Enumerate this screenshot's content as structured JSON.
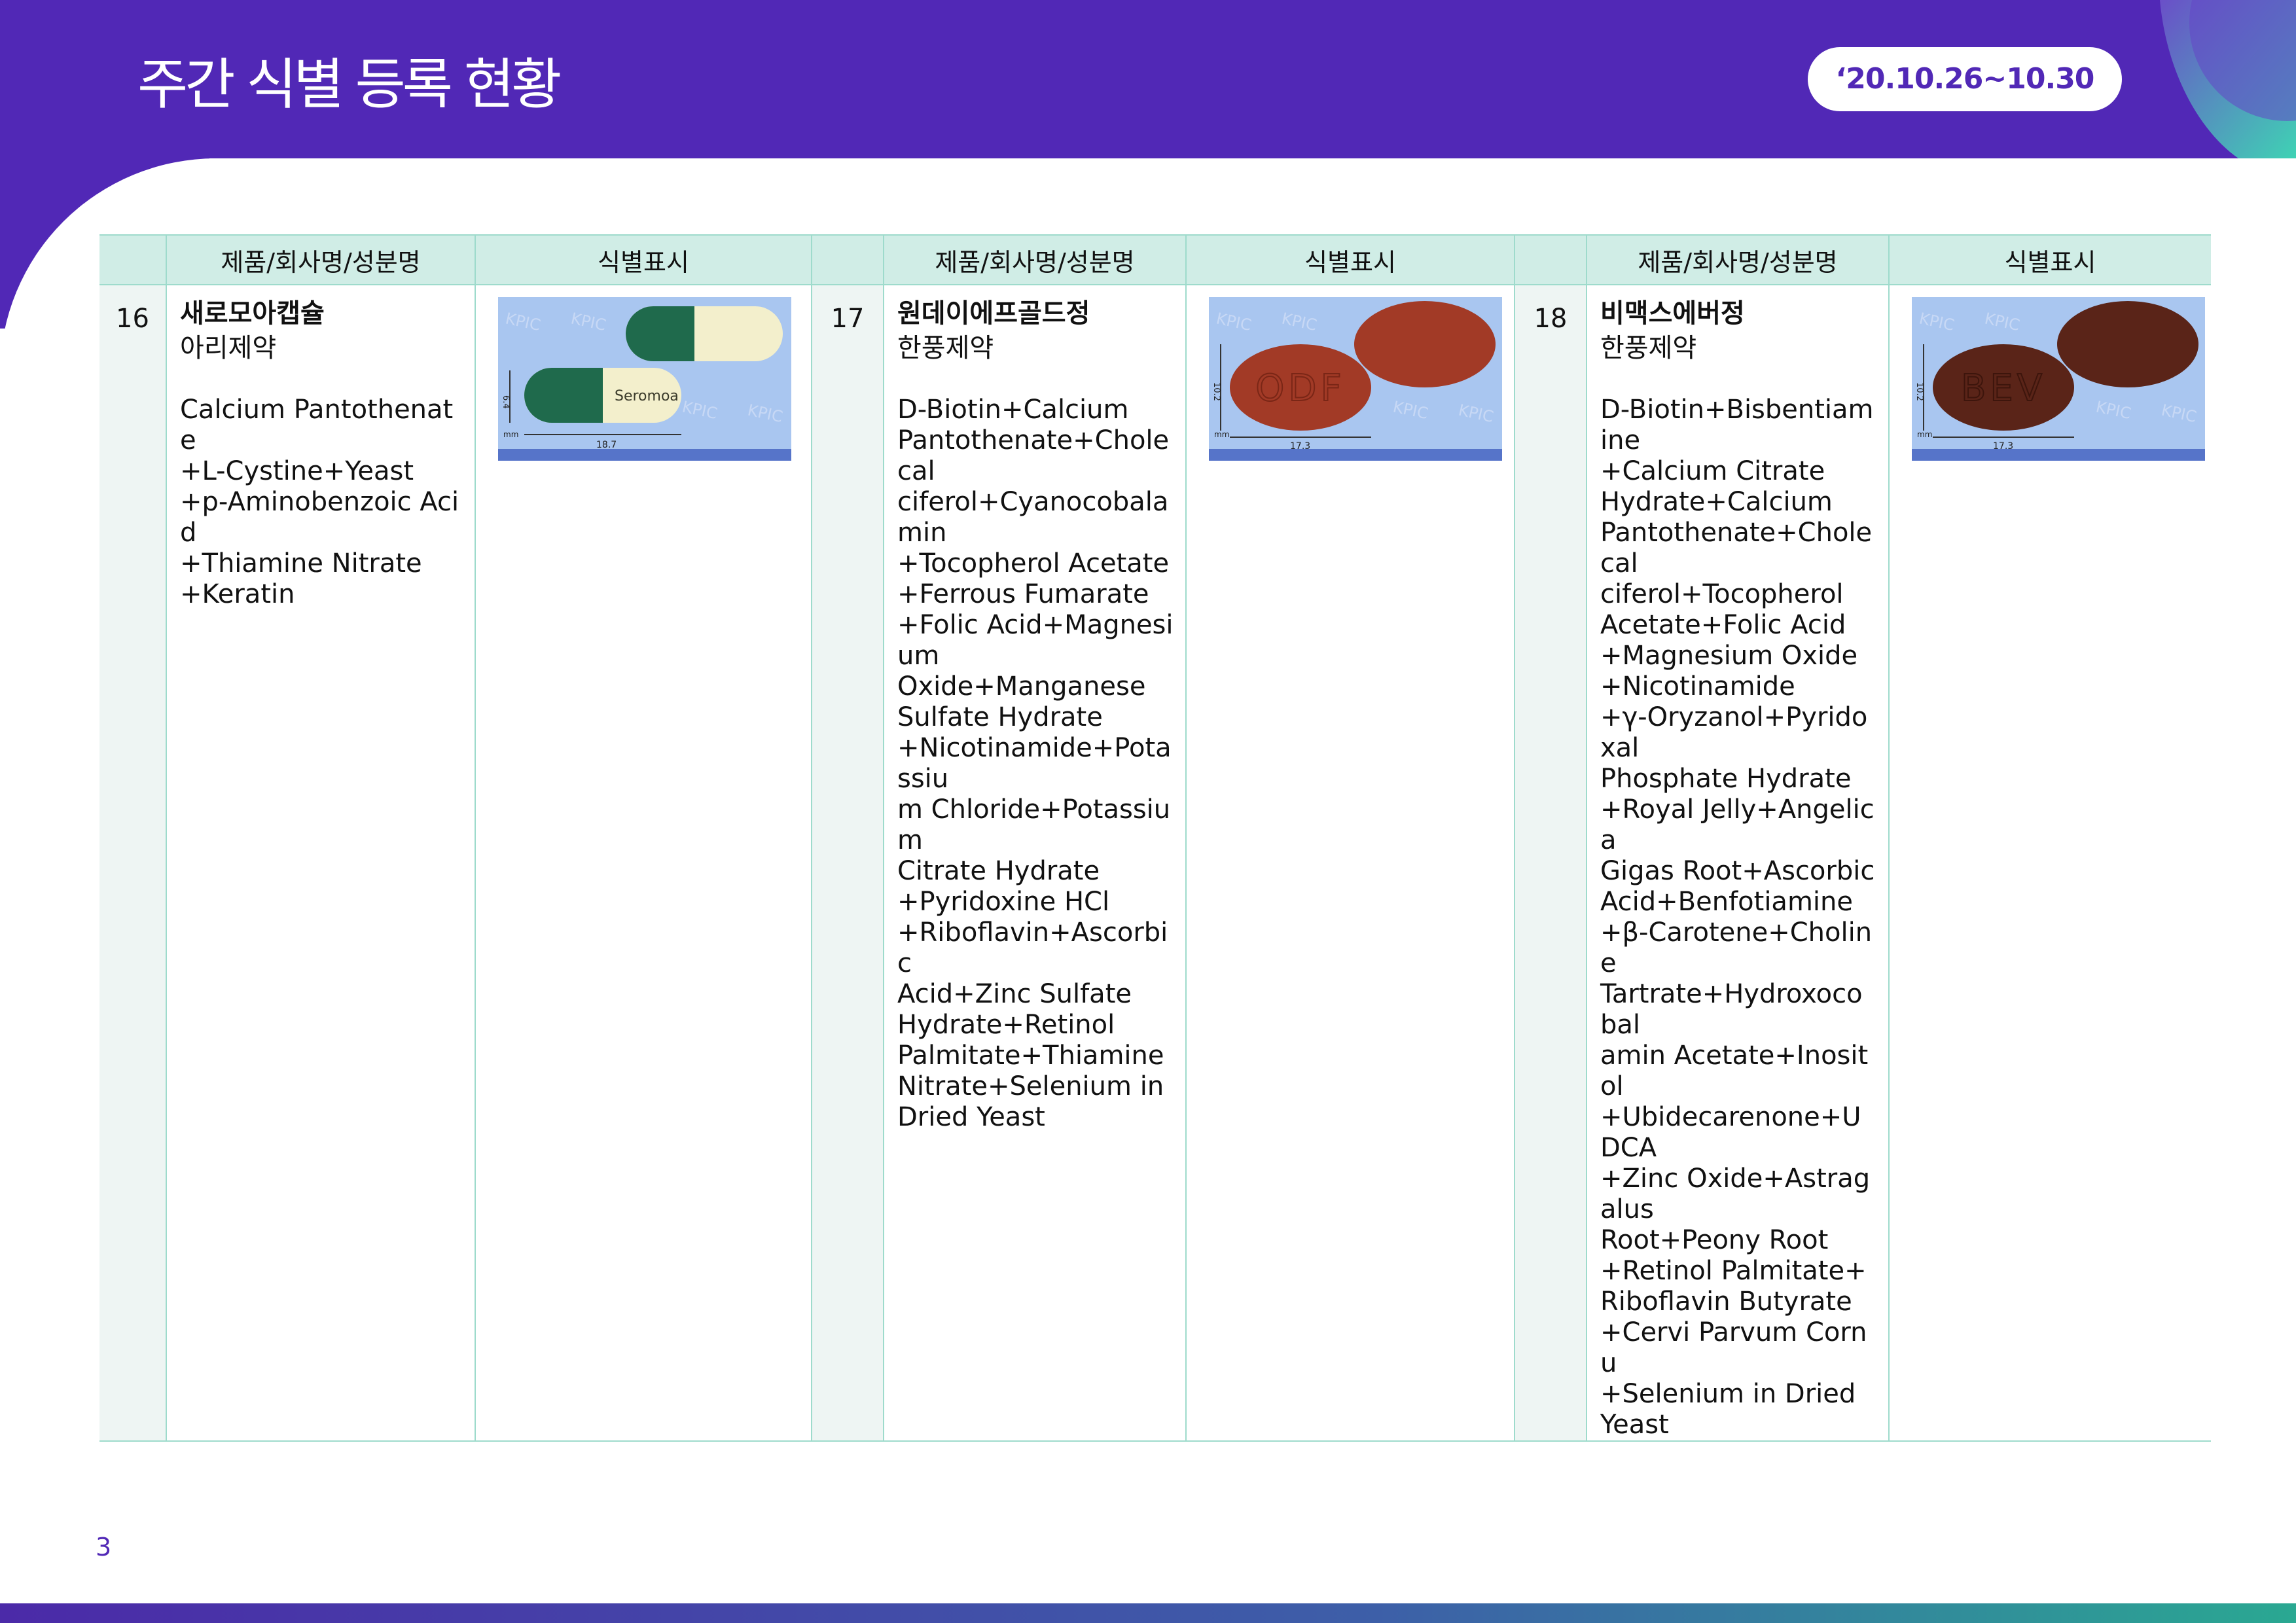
{
  "page": {
    "title": "주간 식별 등록 현황",
    "date_range": "‘20.10.26~10.30",
    "page_number": "3"
  },
  "table": {
    "headers": [
      "제품/회사명/성분명",
      "식별표시",
      "제품/회사명/성분명",
      "식별표시",
      "제품/회사명/성분명",
      "식별표시"
    ],
    "rows": [
      {
        "number": "16",
        "product": "새로모아캡슐",
        "company": "아리제약",
        "ingredients": [
          "Calcium Pantothenate",
          "+L-Cystine+Yeast",
          "+p-Aminobenzoic Acid",
          "+Thiamine Nitrate",
          "+Keratin"
        ],
        "image": {
          "type": "capsule",
          "imprint": "Seromoa",
          "dim_width": "18.7",
          "dim_height": "6.4",
          "unit": "mm",
          "watermark": "KPIC",
          "colors": {
            "cap": "#1f6a4c",
            "body": "#f3efcc"
          }
        }
      },
      {
        "number": "17",
        "product": "원데이에프골드정",
        "company": "한풍제약",
        "ingredients": [
          "D-Biotin+Calcium",
          "Pantothenate+Cholecal",
          "ciferol+Cyanocobalamin",
          "+Tocopherol Acetate",
          "+Ferrous Fumarate",
          "+Folic Acid+Magnesium",
          "Oxide+Manganese",
          "Sulfate Hydrate",
          "+Nicotinamide+Potassiu",
          "m Chloride+Potassium",
          "Citrate Hydrate",
          "+Pyridoxine HCl",
          "+Riboflavin+Ascorbic",
          "Acid+Zinc Sulfate",
          "Hydrate+Retinol",
          "Palmitate+Thiamine",
          "Nitrate+Selenium in",
          "Dried Yeast"
        ],
        "image": {
          "type": "tablet",
          "imprint": "ODF",
          "dim_width": "17.3",
          "dim_height": "10.2",
          "unit": "mm",
          "watermark": "KPIC",
          "colors": {
            "tablet": "#a23a26"
          }
        }
      },
      {
        "number": "18",
        "product": "비맥스에버정",
        "company": "한풍제약",
        "ingredients": [
          "D-Biotin+Bisbentiamine",
          "+Calcium Citrate",
          "Hydrate+Calcium",
          "Pantothenate+Cholecal",
          "ciferol+Tocopherol",
          "Acetate+Folic Acid",
          "+Magnesium Oxide",
          "+Nicotinamide",
          "+γ-Oryzanol+Pyridoxal",
          "Phosphate Hydrate",
          "+Royal Jelly+Angelica",
          "Gigas Root+Ascorbic",
          "Acid+Benfotiamine",
          "+β-Carotene+Choline",
          "Tartrate+Hydroxocobal",
          "amin Acetate+Inositol",
          "+Ubidecarenone+UDCA",
          "+Zinc Oxide+Astragalus",
          "Root+Peony Root",
          "+Retinol Palmitate+",
          "Riboflavin Butyrate",
          "+Cervi Parvum Cornu",
          "+Selenium in Dried",
          "Yeast"
        ],
        "image": {
          "type": "tablet",
          "imprint": "BEV",
          "dim_width": "17.3",
          "dim_height": "10.2",
          "unit": "mm",
          "watermark": "KPIC",
          "colors": {
            "tablet": "#5a2418"
          }
        }
      }
    ]
  },
  "colors": {
    "header_purple": "#5128b6",
    "table_header_bg": "#d0ede6",
    "table_border": "#9edbcc",
    "footer_gradient_start": "#4b2aa8",
    "footer_gradient_end": "#2aa892"
  }
}
